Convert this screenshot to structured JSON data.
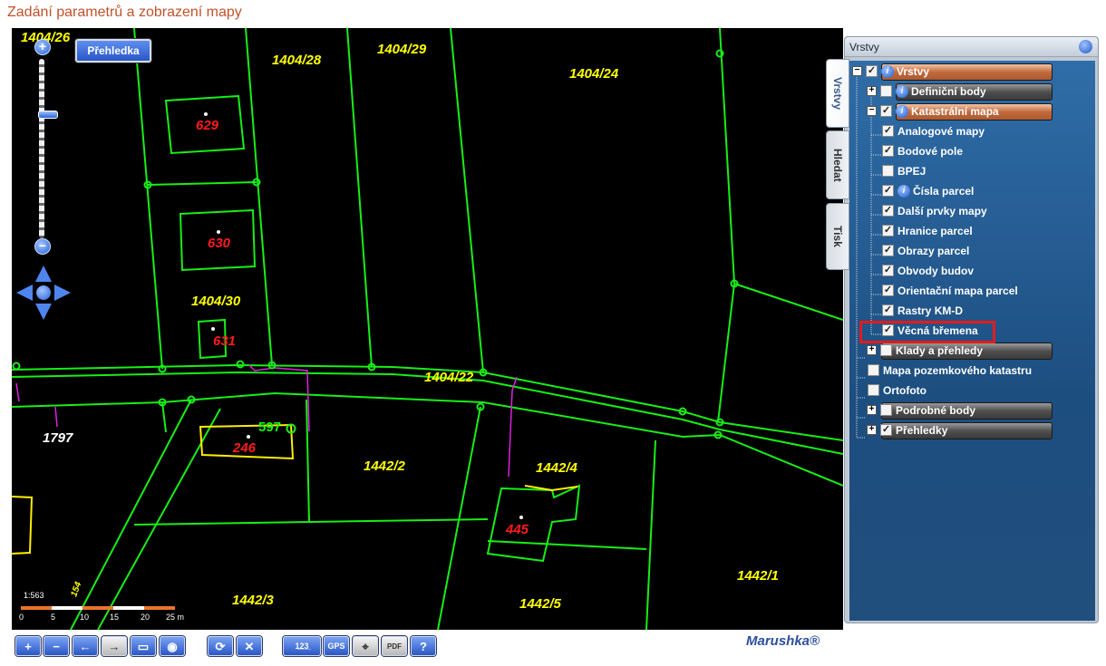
{
  "page_title": "Zadání parametrů a zobrazení mapy",
  "map": {
    "overview_button": "Přehledka",
    "scale_label": "1:563",
    "scale_ticks": [
      "0",
      "5",
      "10",
      "15",
      "20",
      "25 m"
    ],
    "parcel_labels_yellow": [
      "1404/26",
      "1404/28",
      "1404/29",
      "1404/24",
      "1404/30",
      "1404/22",
      "1442/2",
      "1442/4",
      "1442/3",
      "1442/5",
      "1442/1"
    ],
    "building_labels_red": [
      "629",
      "630",
      "631",
      "246",
      "445"
    ],
    "other_labels": {
      "white_parcel": "1797",
      "green_point": "597",
      "vertical_label": "154"
    }
  },
  "toolbar": {
    "buttons": [
      {
        "name": "zoom-in-tool",
        "label": "+"
      },
      {
        "name": "zoom-out-tool",
        "label": "−"
      },
      {
        "name": "back-tool",
        "label": "←"
      },
      {
        "name": "forward-tool",
        "label": "→"
      },
      {
        "name": "zoom-rectangle-tool",
        "label": "▭"
      },
      {
        "name": "full-extent-tool",
        "label": "◉"
      },
      {
        "name": "refresh-tool",
        "label": "⟳"
      },
      {
        "name": "clear-tool",
        "label": "✕"
      },
      {
        "name": "measure-tool",
        "label": "1̲2̲3̲"
      },
      {
        "name": "gps-tool",
        "label": "GPS"
      },
      {
        "name": "select-tool",
        "label": "⌖"
      },
      {
        "name": "pdf-tool",
        "label": "PDF"
      },
      {
        "name": "help-tool",
        "label": "?"
      }
    ],
    "brand": "Marushka®"
  },
  "panel": {
    "title": "Vrstvy",
    "tabs": [
      "Vrstvy",
      "Hledat",
      "Tisk"
    ],
    "tree": [
      {
        "label": "Vrstvy",
        "checked": true,
        "info": true,
        "bar": "orange",
        "expander": "−"
      },
      {
        "label": "Definiční body",
        "checked": false,
        "info": true,
        "bar": "gray",
        "expander": "+"
      },
      {
        "label": "Katastrální mapa",
        "checked": true,
        "info": true,
        "bar": "orange",
        "expander": "−"
      },
      {
        "label": "Analogové mapy",
        "checked": true
      },
      {
        "label": "Bodové pole",
        "checked": true
      },
      {
        "label": "BPEJ",
        "checked": false
      },
      {
        "label": "Čísla parcel",
        "checked": true,
        "info": true
      },
      {
        "label": "Další prvky mapy",
        "checked": true
      },
      {
        "label": "Hranice parcel",
        "checked": true
      },
      {
        "label": "Obrazy parcel",
        "checked": true
      },
      {
        "label": "Obvody budov",
        "checked": true
      },
      {
        "label": "Orientační mapa parcel",
        "checked": true
      },
      {
        "label": "Rastry KM-D",
        "checked": true
      },
      {
        "label": "Věcná břemena",
        "checked": true
      },
      {
        "label": "Klady a přehledy",
        "checked": false,
        "bar": "gray",
        "expander": "+"
      },
      {
        "label": "Mapa pozemkového katastru",
        "checked": false
      },
      {
        "label": "Ortofoto",
        "checked": false
      },
      {
        "label": "Podrobné body",
        "checked": false,
        "bar": "gray",
        "expander": "+"
      },
      {
        "label": "Přehledky",
        "checked": true,
        "bar": "gray",
        "expander": "+"
      }
    ]
  }
}
